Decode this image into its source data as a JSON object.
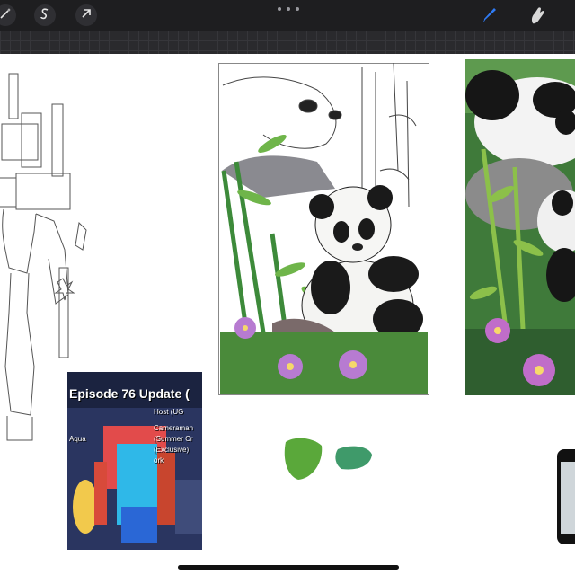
{
  "toolbar": {
    "left_tools": [
      {
        "icon": "magic-wand-icon"
      },
      {
        "icon": "selection-s-icon"
      },
      {
        "icon": "transform-arrow-icon"
      }
    ],
    "more_icon": "more-dots-icon",
    "right_tools": [
      {
        "icon": "brush-icon",
        "color": "#2f7bf5"
      },
      {
        "icon": "smudge-icon",
        "color": "#d8d8d8"
      }
    ]
  },
  "game_screenshot": {
    "title": "Episode 76 Update (",
    "items": [
      "Host (UG",
      "Cameraman",
      "Aqua",
      "(Summer Cr",
      "(Exclusive)",
      "ork"
    ]
  },
  "colors": {
    "toolbar_bg": "#1e1e20",
    "canvas_bg": "#ffffff",
    "swatch_1": "#5aa83a",
    "swatch_2": "#3f9a6a",
    "accent": "#2f7bf5"
  }
}
